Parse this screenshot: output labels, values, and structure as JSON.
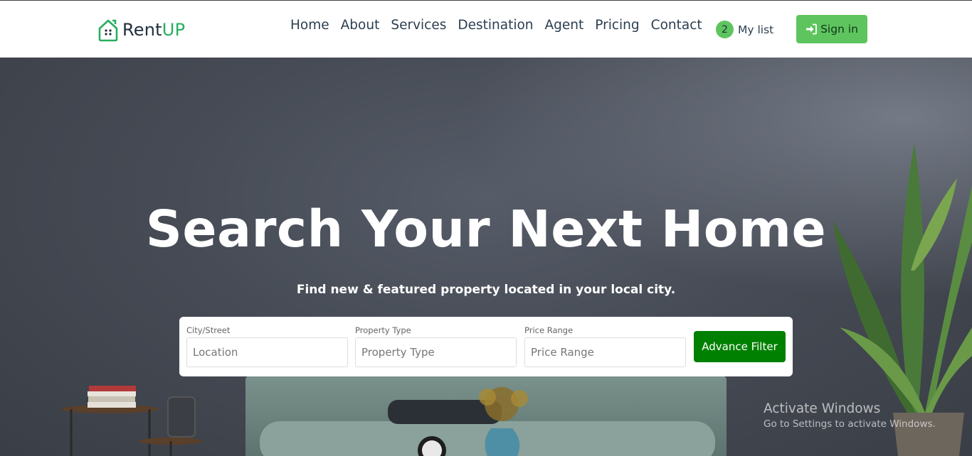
{
  "brand": {
    "name_main": "Rent",
    "name_accent": "UP",
    "accent_color": "#27ae60"
  },
  "nav": {
    "items": [
      "Home",
      "About",
      "Services",
      "Destination",
      "Agent",
      "Pricing",
      "Contact"
    ]
  },
  "header": {
    "mylist_count": "2",
    "mylist_label": "My list",
    "signin_label": "Sign in",
    "button_color": "#5ec55e"
  },
  "hero": {
    "title": "Search Your Next Home",
    "subtitle": "Find new & featured property located in your local city."
  },
  "search": {
    "fields": [
      {
        "label": "City/Street",
        "placeholder": "Location",
        "value": ""
      },
      {
        "label": "Property Type",
        "placeholder": "Property Type",
        "value": ""
      },
      {
        "label": "Price Range",
        "placeholder": "Price Range",
        "value": ""
      }
    ],
    "filter_label": "Advance Filter",
    "filter_color": "#008000"
  },
  "watermark": {
    "title": "Activate Windows",
    "subtitle": "Go to Settings to activate Windows."
  }
}
